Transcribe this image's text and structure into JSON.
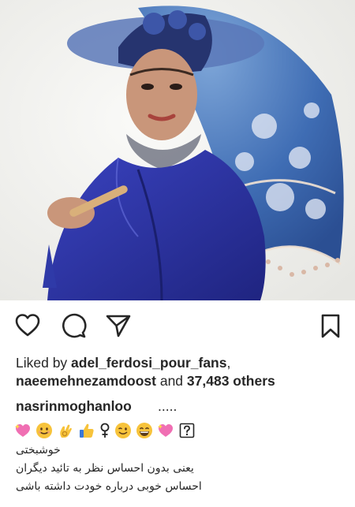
{
  "post": {
    "image_alt": "Woman in blue hat and blue lace parasol"
  },
  "actions": {
    "like_icon": "heart-icon",
    "comment_icon": "comment-bubble-icon",
    "share_icon": "paper-plane-icon",
    "save_icon": "bookmark-icon"
  },
  "likes": {
    "prefix": "Liked by ",
    "user1": "adel_ferdosi_pour_fans",
    "separator": ",",
    "user2": "naeemehnezamdoost",
    "middle": " and ",
    "count": "37,483 others"
  },
  "caption": {
    "username": "nasrinmoghanloo",
    "ellipsis": ".....",
    "emojis": [
      "sparkling-heart",
      "smiling-face",
      "ok-hand",
      "thumbs-up",
      "female-sign",
      "winking-face",
      "grinning-face",
      "sparkling-heart",
      "question-mark-box"
    ],
    "lines": [
      "خوشبختی",
      "یعنی بدون احساس نظر به تائید دیگران",
      "احساس خوبی درباره خودت داشته باشی"
    ]
  },
  "colors": {
    "text": "#262626",
    "accent_blue": "#2f3aa8",
    "background": "#ffffff"
  }
}
